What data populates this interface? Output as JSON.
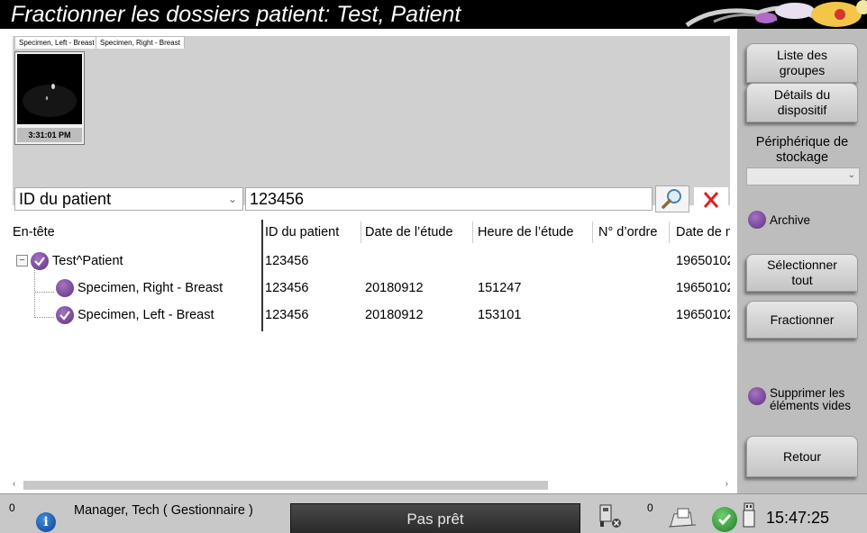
{
  "title": "Fractionner les dossiers patient: Test, Patient",
  "thumb_tabs": [
    "Specimen, Left - Breast",
    "Specimen, Right - Breast"
  ],
  "thumbnail": {
    "time": "3:31:01 PM"
  },
  "search": {
    "type": "ID du patient",
    "value": "123456"
  },
  "table": {
    "headers": [
      "En-tête",
      "ID du patient",
      "Date de l’étude",
      "Heure de l’étude",
      "N° d’ordre",
      "Date de naissance"
    ],
    "rows": [
      {
        "label": "Test^Patient",
        "patient_id": "123456",
        "date": "",
        "time": "",
        "order": "",
        "birth": "19650102"
      },
      {
        "label": "Specimen, Right - Breast",
        "patient_id": "123456",
        "date": "20180912",
        "time": "151247",
        "order": "",
        "birth": "19650102"
      },
      {
        "label": "Specimen, Left - Breast",
        "patient_id": "123456",
        "date": "20180912",
        "time": "153101",
        "order": "",
        "birth": "19650102"
      }
    ]
  },
  "right_panel": {
    "group_list": "Liste des groupes",
    "device_details": "Détails du dispositif",
    "storage_label": "Périphérique de stockage",
    "archive": "Archive",
    "select_all": "Sélectionner tout",
    "split": "Fractionner",
    "delete_empty": "Supprimer les éléments vides",
    "back": "Retour"
  },
  "status": {
    "count_left": "0",
    "user": "Manager, Tech ( Gestionnaire )",
    "state": "Pas prêt",
    "count_right": "0",
    "time": "15:47:25"
  },
  "colors": {
    "accent_purple": "#7a4a9e",
    "status_ok": "#2e9e3a",
    "clear_red": "#e02020"
  }
}
